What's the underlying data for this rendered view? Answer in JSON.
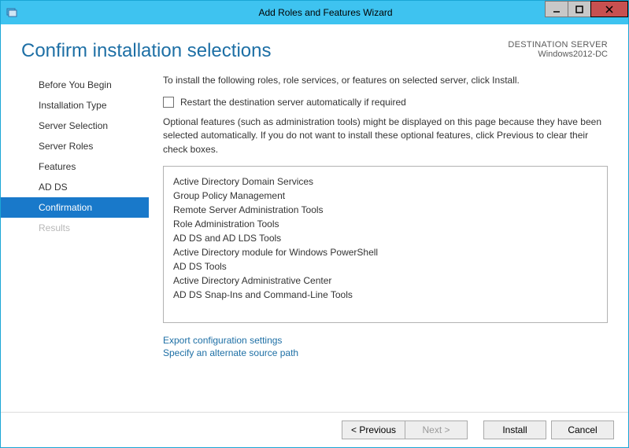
{
  "titlebar": {
    "title": "Add Roles and Features Wizard"
  },
  "header": {
    "page_title": "Confirm installation selections",
    "dest_label": "DESTINATION SERVER",
    "dest_value": "Windows2012-DC"
  },
  "sidebar": {
    "items": [
      {
        "label": "Before You Begin"
      },
      {
        "label": "Installation Type"
      },
      {
        "label": "Server Selection"
      },
      {
        "label": "Server Roles"
      },
      {
        "label": "Features"
      },
      {
        "label": "AD DS"
      },
      {
        "label": "Confirmation"
      },
      {
        "label": "Results"
      }
    ]
  },
  "main": {
    "intro": "To install the following roles, role services, or features on selected server, click Install.",
    "restart_label": "Restart the destination server automatically if required",
    "note": "Optional features (such as administration tools) might be displayed on this page because they have been selected automatically. If you do not want to install these optional features, click Previous to clear their check boxes.",
    "list": {
      "i0": "Active Directory Domain Services",
      "i1": "Group Policy Management",
      "i2": "Remote Server Administration Tools",
      "i3": "Role Administration Tools",
      "i4": "AD DS and AD LDS Tools",
      "i5": "Active Directory module for Windows PowerShell",
      "i6": "AD DS Tools",
      "i7": "Active Directory Administrative Center",
      "i8": "AD DS Snap-Ins and Command-Line Tools"
    },
    "link_export": "Export configuration settings",
    "link_altpath": "Specify an alternate source path"
  },
  "footer": {
    "previous": "< Previous",
    "next": "Next >",
    "install": "Install",
    "cancel": "Cancel"
  }
}
